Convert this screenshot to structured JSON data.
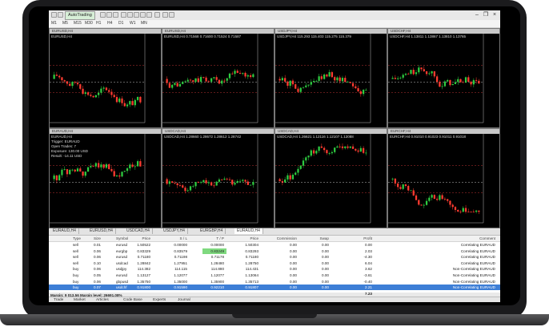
{
  "toolbar": {
    "autotrading_label": "AutoTrading"
  },
  "timeframes": [
    "M1",
    "M5",
    "M15",
    "M30",
    "H1",
    "H4",
    "D1",
    "W1",
    "MN"
  ],
  "charts": [
    {
      "title": "EURUSD,H4",
      "symbol": "EURUSD,H4"
    },
    {
      "title": "EURUSD,H4",
      "symbol": "EURUSD,H4  0.71568 0.71600 0.71524 0.71587"
    },
    {
      "title": "USDJPY,H4",
      "symbol": "USDJPY,H4  115.293 115.403 115.275 115.379"
    },
    {
      "title": "USDCHF,H4",
      "symbol": "USDCHF,H4  1.13811 1.13867 1.13810 1.13765"
    },
    {
      "title": "EURAUD,H4",
      "symbol": "EURAUD,H4",
      "info": [
        "Trigger: EURAUD",
        "Open Trades: 7",
        "Exposure: 130.00 USD",
        "Result: -14.11 USD"
      ]
    },
    {
      "title": "USDCAD,H4",
      "symbol": "USDCAD,H4  1.28660 1.28672 1.28612 1.28742"
    },
    {
      "title": "USDCAD,H4",
      "symbol": "USDCAD,H4  1.26621 1.12116 1.12107 1.12088"
    },
    {
      "title": "EURCHF,H4",
      "symbol": "EURCHF,H4  0.91010 0.91023 0.91011 0.91018"
    }
  ],
  "chart_tabs": [
    "EURAUD,H4",
    "EURUSD,H4",
    "USDCAD,H4",
    "USDJPY,H4",
    "EURGBP,H4",
    "EURAUD,H4"
  ],
  "terminal": {
    "columns": [
      "Type",
      "Size",
      "Symbol",
      "Price",
      "S / L",
      "T / P",
      "Price",
      "Commission",
      "Swap",
      "Profit",
      "Comment"
    ],
    "rows": [
      [
        "sell",
        "0.01",
        "eurusd",
        "1.50522",
        "0.00000",
        "0.00000",
        "1.50304",
        "0.00",
        "0.00",
        "0.00",
        "Correlating EURAUD"
      ],
      [
        "sell",
        "0.06",
        "eurgbp",
        "0.83329",
        "0.83579",
        "0.83249",
        "0.83293",
        "0.00",
        "0.00",
        "2.03",
        "Correlating EURAUD"
      ],
      [
        "sell",
        "0.06",
        "eurusd",
        "0.71180",
        "0.71198",
        "0.71178",
        "0.71180",
        "0.00",
        "0.00",
        "-4.30",
        "Correlating EURAUD"
      ],
      [
        "sell",
        "0.10",
        "usdcad",
        "1.28842",
        "1.27951",
        "1.28480",
        "1.28750",
        "0.00",
        "0.00",
        "6.04",
        "Correlating EURAUD"
      ],
      [
        "buy",
        "0.06",
        "usdjpy",
        "114.382",
        "114.115",
        "114.880",
        "114.431",
        "0.00",
        "0.00",
        "3.62",
        "Non-Correlating EURAUD"
      ],
      [
        "buy",
        "0.05",
        "eurusd",
        "1.13127",
        "1.12077",
        "1.12077",
        "1.13064",
        "0.00",
        "0.00",
        "-3.61",
        "Non-Correlating EURAUD"
      ],
      [
        "buy",
        "0.06",
        "gbpusd",
        "1.35750",
        "1.35000",
        "1.35900",
        "1.35713",
        "0.00",
        "0.00",
        "-0.40",
        "Non-Correlating EURAUD"
      ],
      [
        "buy",
        "0.07",
        "usdchf",
        "0.91800",
        "0.91590",
        "0.92210",
        "0.91807",
        "0.00",
        "0.00",
        "2.21",
        "Non-Correlating EURAUD"
      ]
    ],
    "highlight_tp_row": 1,
    "selected_row": 7,
    "total_profit": "7.23",
    "balance_line": "Margin: 9 013.56  Margin level: 26691.08%"
  },
  "bottom_tabs": [
    "Trade",
    "Market",
    "Articles",
    "Code Base",
    "Experts",
    "Journal"
  ],
  "colors": {
    "bull": "#2ecc40",
    "bear": "#ff3b30",
    "selection": "#3d7ed6",
    "tp_highlight": "#7fd97f"
  }
}
